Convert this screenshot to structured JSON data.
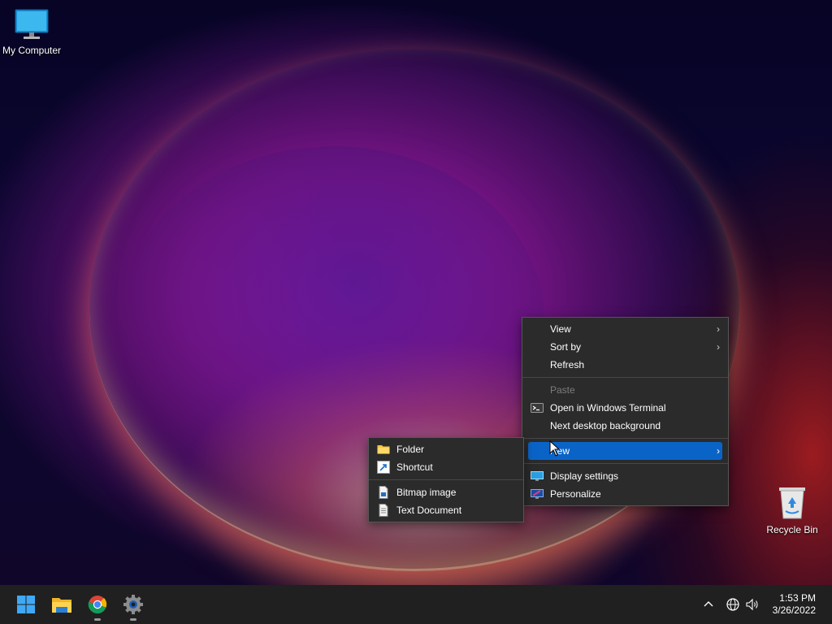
{
  "desktop": {
    "icons": [
      {
        "label": "My Computer"
      },
      {
        "label": "Recycle Bin"
      }
    ]
  },
  "context_menu": {
    "items": [
      {
        "label": "View",
        "has_submenu": true
      },
      {
        "label": "Sort by",
        "has_submenu": true
      },
      {
        "label": "Refresh"
      },
      {
        "label": "Paste",
        "disabled": true
      },
      {
        "label": "Open in Windows Terminal",
        "icon": "terminal-icon"
      },
      {
        "label": "Next desktop background"
      },
      {
        "label": "New",
        "has_submenu": true,
        "highlighted": true
      },
      {
        "label": "Display settings",
        "icon": "display-icon"
      },
      {
        "label": "Personalize",
        "icon": "personalize-icon"
      }
    ]
  },
  "new_submenu": {
    "items": [
      {
        "label": "Folder",
        "icon": "folder-icon"
      },
      {
        "label": "Shortcut",
        "icon": "shortcut-icon"
      },
      {
        "label": "Bitmap image",
        "icon": "bitmap-icon"
      },
      {
        "label": "Text Document",
        "icon": "text-document-icon"
      }
    ]
  },
  "taskbar": {
    "apps": [
      "start-icon",
      "file-explorer-icon",
      "chrome-icon",
      "settings-icon"
    ],
    "tray": {
      "time": "1:53 PM",
      "date": "3/26/2022"
    }
  },
  "colors": {
    "highlight": "#0a64c8",
    "menu_bg": "#2b2b2b",
    "taskbar_bg": "#202020"
  }
}
